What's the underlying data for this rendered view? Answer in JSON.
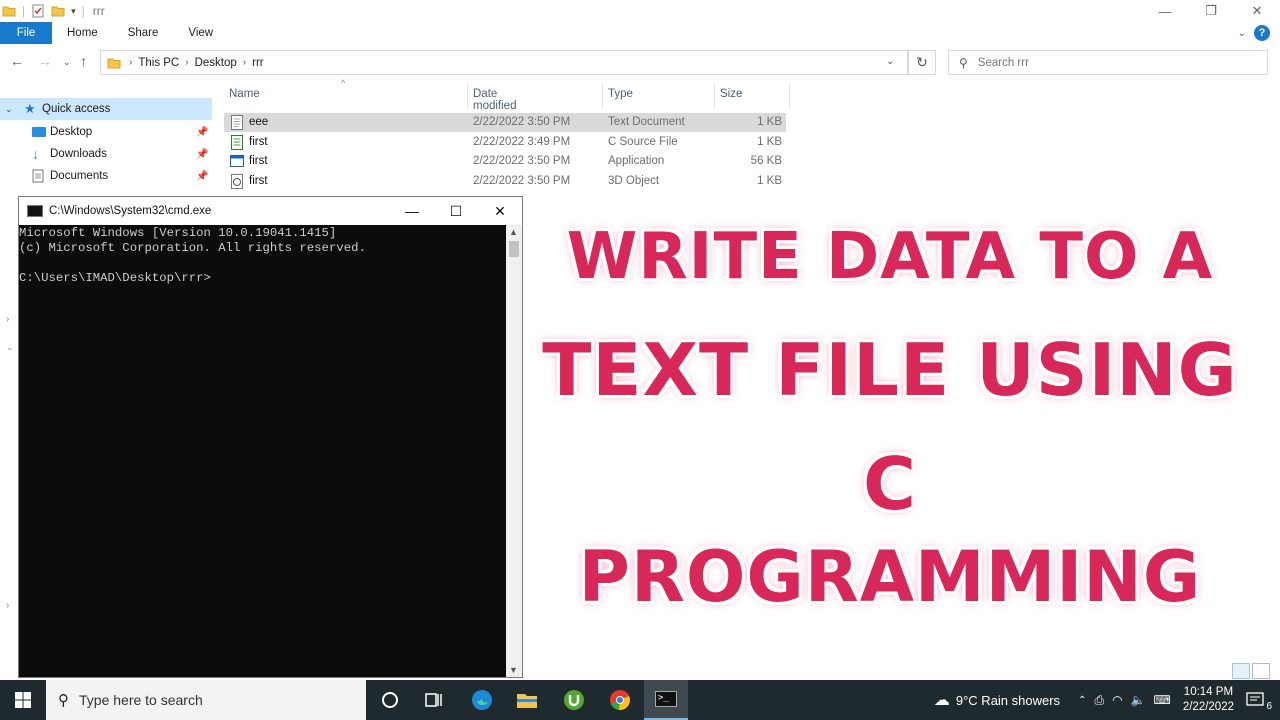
{
  "window": {
    "title": "rrr",
    "ctrl_minimize": "—",
    "ctrl_restore": "❐",
    "ctrl_close": "✕"
  },
  "ribbon": {
    "tabs": [
      "File",
      "Home",
      "Share",
      "View"
    ]
  },
  "address": {
    "crumbs": [
      "This PC",
      "Desktop",
      "rrr"
    ],
    "search_placeholder": "Search rrr"
  },
  "nav": {
    "items": [
      {
        "label": "Quick access",
        "icon": "star-icon"
      },
      {
        "label": "Desktop",
        "icon": "desktop-folder-icon"
      },
      {
        "label": "Downloads",
        "icon": "download-icon"
      },
      {
        "label": "Documents",
        "icon": "documents-icon"
      }
    ]
  },
  "columns": {
    "name": "Name",
    "date": "Date modified",
    "type": "Type",
    "size": "Size"
  },
  "files": [
    {
      "name": "eee",
      "date": "2/22/2022 3:50 PM",
      "type": "Text Document",
      "size": "1 KB",
      "icon": "text-file-icon"
    },
    {
      "name": "first",
      "date": "2/22/2022 3:49 PM",
      "type": "C Source File",
      "size": "1 KB",
      "icon": "c-source-icon"
    },
    {
      "name": "first",
      "date": "2/22/2022 3:50 PM",
      "type": "Application",
      "size": "56 KB",
      "icon": "application-icon"
    },
    {
      "name": "first",
      "date": "2/22/2022 3:50 PM",
      "type": "3D Object",
      "size": "1 KB",
      "icon": "3d-object-icon"
    }
  ],
  "cmd": {
    "title": "C:\\Windows\\System32\\cmd.exe",
    "lines": "Microsoft Windows [Version 10.0.19041.1415]\n(c) Microsoft Corporation. All rights reserved.\n\nC:\\Users\\IMAD\\Desktop\\rrr>"
  },
  "banner": {
    "line1": "WRITE DATA TO A",
    "line2": "TEXT FILE USING",
    "line3": "C",
    "line4": "PROGRAMMING"
  },
  "taskbar": {
    "search_placeholder": "Type here to search",
    "weather": "9°C  Rain showers",
    "time": "10:14 PM",
    "date": "2/22/2022",
    "notifications": "6"
  },
  "colors": {
    "accent": "#1979ca",
    "banner": "#d8285a",
    "selection": "#cce8ff",
    "taskbar": "#1f2a2e"
  }
}
